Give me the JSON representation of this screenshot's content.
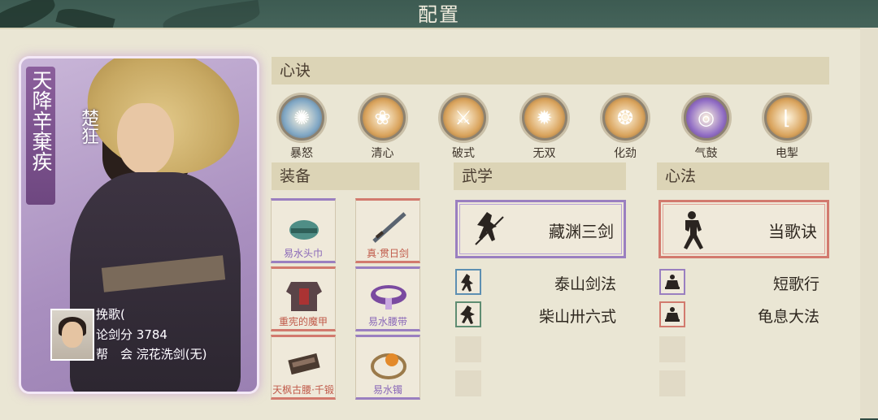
{
  "header": {
    "title": "配置"
  },
  "character": {
    "title_banner": "天降辛棄疾",
    "name": "楚狂",
    "player_name": "挽歌(",
    "score_label": "论剑分",
    "score_value": "3784",
    "guild_label": "帮　会",
    "guild_value": "浣花洗剑(无)"
  },
  "sections": {
    "heart": "心诀",
    "equipment": "装备",
    "martial": "武学",
    "mind": "心法"
  },
  "heart_skills": [
    {
      "label": "暴怒",
      "icon": "wolf-icon",
      "color": "#7fa6c4"
    },
    {
      "label": "清心",
      "icon": "lotus-icon",
      "color": "#d9a35c"
    },
    {
      "label": "破式",
      "icon": "slash-icon",
      "color": "#d9a35c"
    },
    {
      "label": "无双",
      "icon": "burst-icon",
      "color": "#d9a35c"
    },
    {
      "label": "化劲",
      "icon": "swirl-icon",
      "color": "#d9a35c"
    },
    {
      "label": "气鼓",
      "icon": "vortex-icon",
      "color": "#8f6bc4"
    },
    {
      "label": "电掣",
      "icon": "boot-icon",
      "color": "#d9a35c"
    }
  ],
  "equipment": [
    {
      "name": "易水头巾",
      "rarity": "purple",
      "icon": "headband-icon"
    },
    {
      "name": "真·贯日剑",
      "rarity": "red",
      "icon": "sword-icon"
    },
    {
      "name": "重宪的魔甲",
      "rarity": "red",
      "icon": "armor-icon"
    },
    {
      "name": "易水腰带",
      "rarity": "purple",
      "icon": "belt-icon"
    },
    {
      "name": "天枫古腰·千锻",
      "rarity": "red",
      "icon": "scroll-icon"
    },
    {
      "name": "易水镯",
      "rarity": "purple",
      "icon": "bracelet-icon"
    }
  ],
  "martial_arts": {
    "main": {
      "name": "藏渊三剑",
      "rarity": "purple"
    },
    "subs": [
      {
        "name": "泰山剑法",
        "rarity": "blue"
      },
      {
        "name": "柴山卅六式",
        "rarity": "green"
      }
    ]
  },
  "mind_methods": {
    "main": {
      "name": "当歌诀",
      "rarity": "red"
    },
    "subs": [
      {
        "name": "短歌行",
        "rarity": "purple"
      },
      {
        "name": "龟息大法",
        "rarity": "red"
      }
    ]
  },
  "colors": {
    "purple": "#9a7fc0",
    "red": "#d27a6e",
    "blue": "#5d8fb2",
    "green": "#5f8d72"
  }
}
